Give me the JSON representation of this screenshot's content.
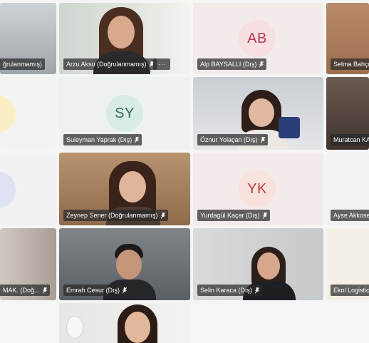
{
  "participants": [
    {
      "id": "p1",
      "label": "ğrulanmamış)"
    },
    {
      "id": "p2",
      "label": "Arzu Aksu (Doğrulanmamış)",
      "more": "···"
    },
    {
      "id": "p3",
      "label": "Alp BAYSALLI (Dış)",
      "initials": "AB"
    },
    {
      "id": "p4",
      "label": "Selma Bahçıv"
    },
    {
      "id": "p5",
      "label": "Suleyman Yaprak (Dış)",
      "initials": "SY"
    },
    {
      "id": "p6",
      "label": "Öznur Yolaçan (Dış)"
    },
    {
      "id": "p7",
      "label": "Muratcan KA"
    },
    {
      "id": "p8",
      "label": "Zeynep Sener (Doğrulanmamış)"
    },
    {
      "id": "p9",
      "label": "Yurdagül Kaçar (Dış)",
      "initials": "YK"
    },
    {
      "id": "p10",
      "label": "Ayse Akkose"
    },
    {
      "id": "p11",
      "label": "MAK. (Doğ..."
    },
    {
      "id": "p12",
      "label": "Emrah Cesur (Dış)"
    },
    {
      "id": "p13",
      "label": "Selin Karaca (Dış)"
    },
    {
      "id": "p14",
      "label": "Ekol Logistic"
    }
  ],
  "colors": {
    "ab_bg": "#f7dfe2",
    "ab_fg": "#b63a4e",
    "sy_bg": "#d9ece3",
    "sy_fg": "#2f6f51",
    "yk_bg": "#f9e1de",
    "yk_fg": "#b8413a",
    "partial_yellow": "#fbeec4",
    "partial_blue": "#dfe2f3"
  }
}
